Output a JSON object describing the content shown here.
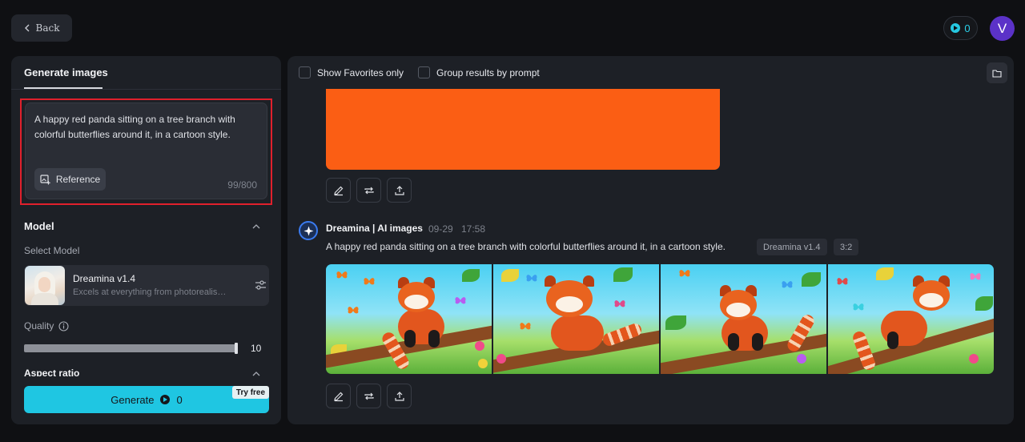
{
  "header": {
    "back_label": "Back",
    "credits": "0",
    "avatar_initial": "V"
  },
  "left_panel": {
    "tab_label": "Generate images",
    "prompt_text": "A happy red panda sitting on a tree branch with colorful butterflies around it, in a cartoon style.",
    "reference_label": "Reference",
    "char_count": "99/800",
    "model_section_title": "Model",
    "select_model_label": "Select Model",
    "model_name": "Dreamina v1.4",
    "model_description": "Excels at everything from photorealism to painting, anime and more",
    "quality_label": "Quality",
    "quality_value": "10",
    "quality_fraction": 1.0,
    "aspect_ratio_label": "Aspect ratio",
    "generate_label": "Generate",
    "generate_cost": "0",
    "try_free_label": "Try free"
  },
  "results": {
    "show_favorites_label": "Show Favorites only",
    "group_by_prompt_label": "Group results by prompt",
    "bot_name": "Dreamina | AI images",
    "date": "09-29",
    "time": "17:58",
    "prompt": "A happy red panda sitting on a tree branch with colorful butterflies around it, in a cartoon style.",
    "model_tag": "Dreamina v1.4",
    "ratio_tag": "3:2"
  },
  "icons": {
    "back": "chevron-left-icon",
    "credits": "play-coin-icon",
    "reference": "image-plus-icon",
    "collapse": "chevron-up-icon",
    "model_settings": "sliders-icon",
    "quality_info": "info-icon",
    "folder": "folder-icon",
    "edit": "pencil-icon",
    "regenerate": "repeat-icon",
    "export": "upload-icon",
    "bot": "sparkle-icon"
  },
  "colors": {
    "accent": "#1fc6e2",
    "highlight_border": "#e0202c",
    "avatar": "#5b32c8",
    "panel_bg": "#1d2026",
    "page_bg": "#0f1013"
  }
}
